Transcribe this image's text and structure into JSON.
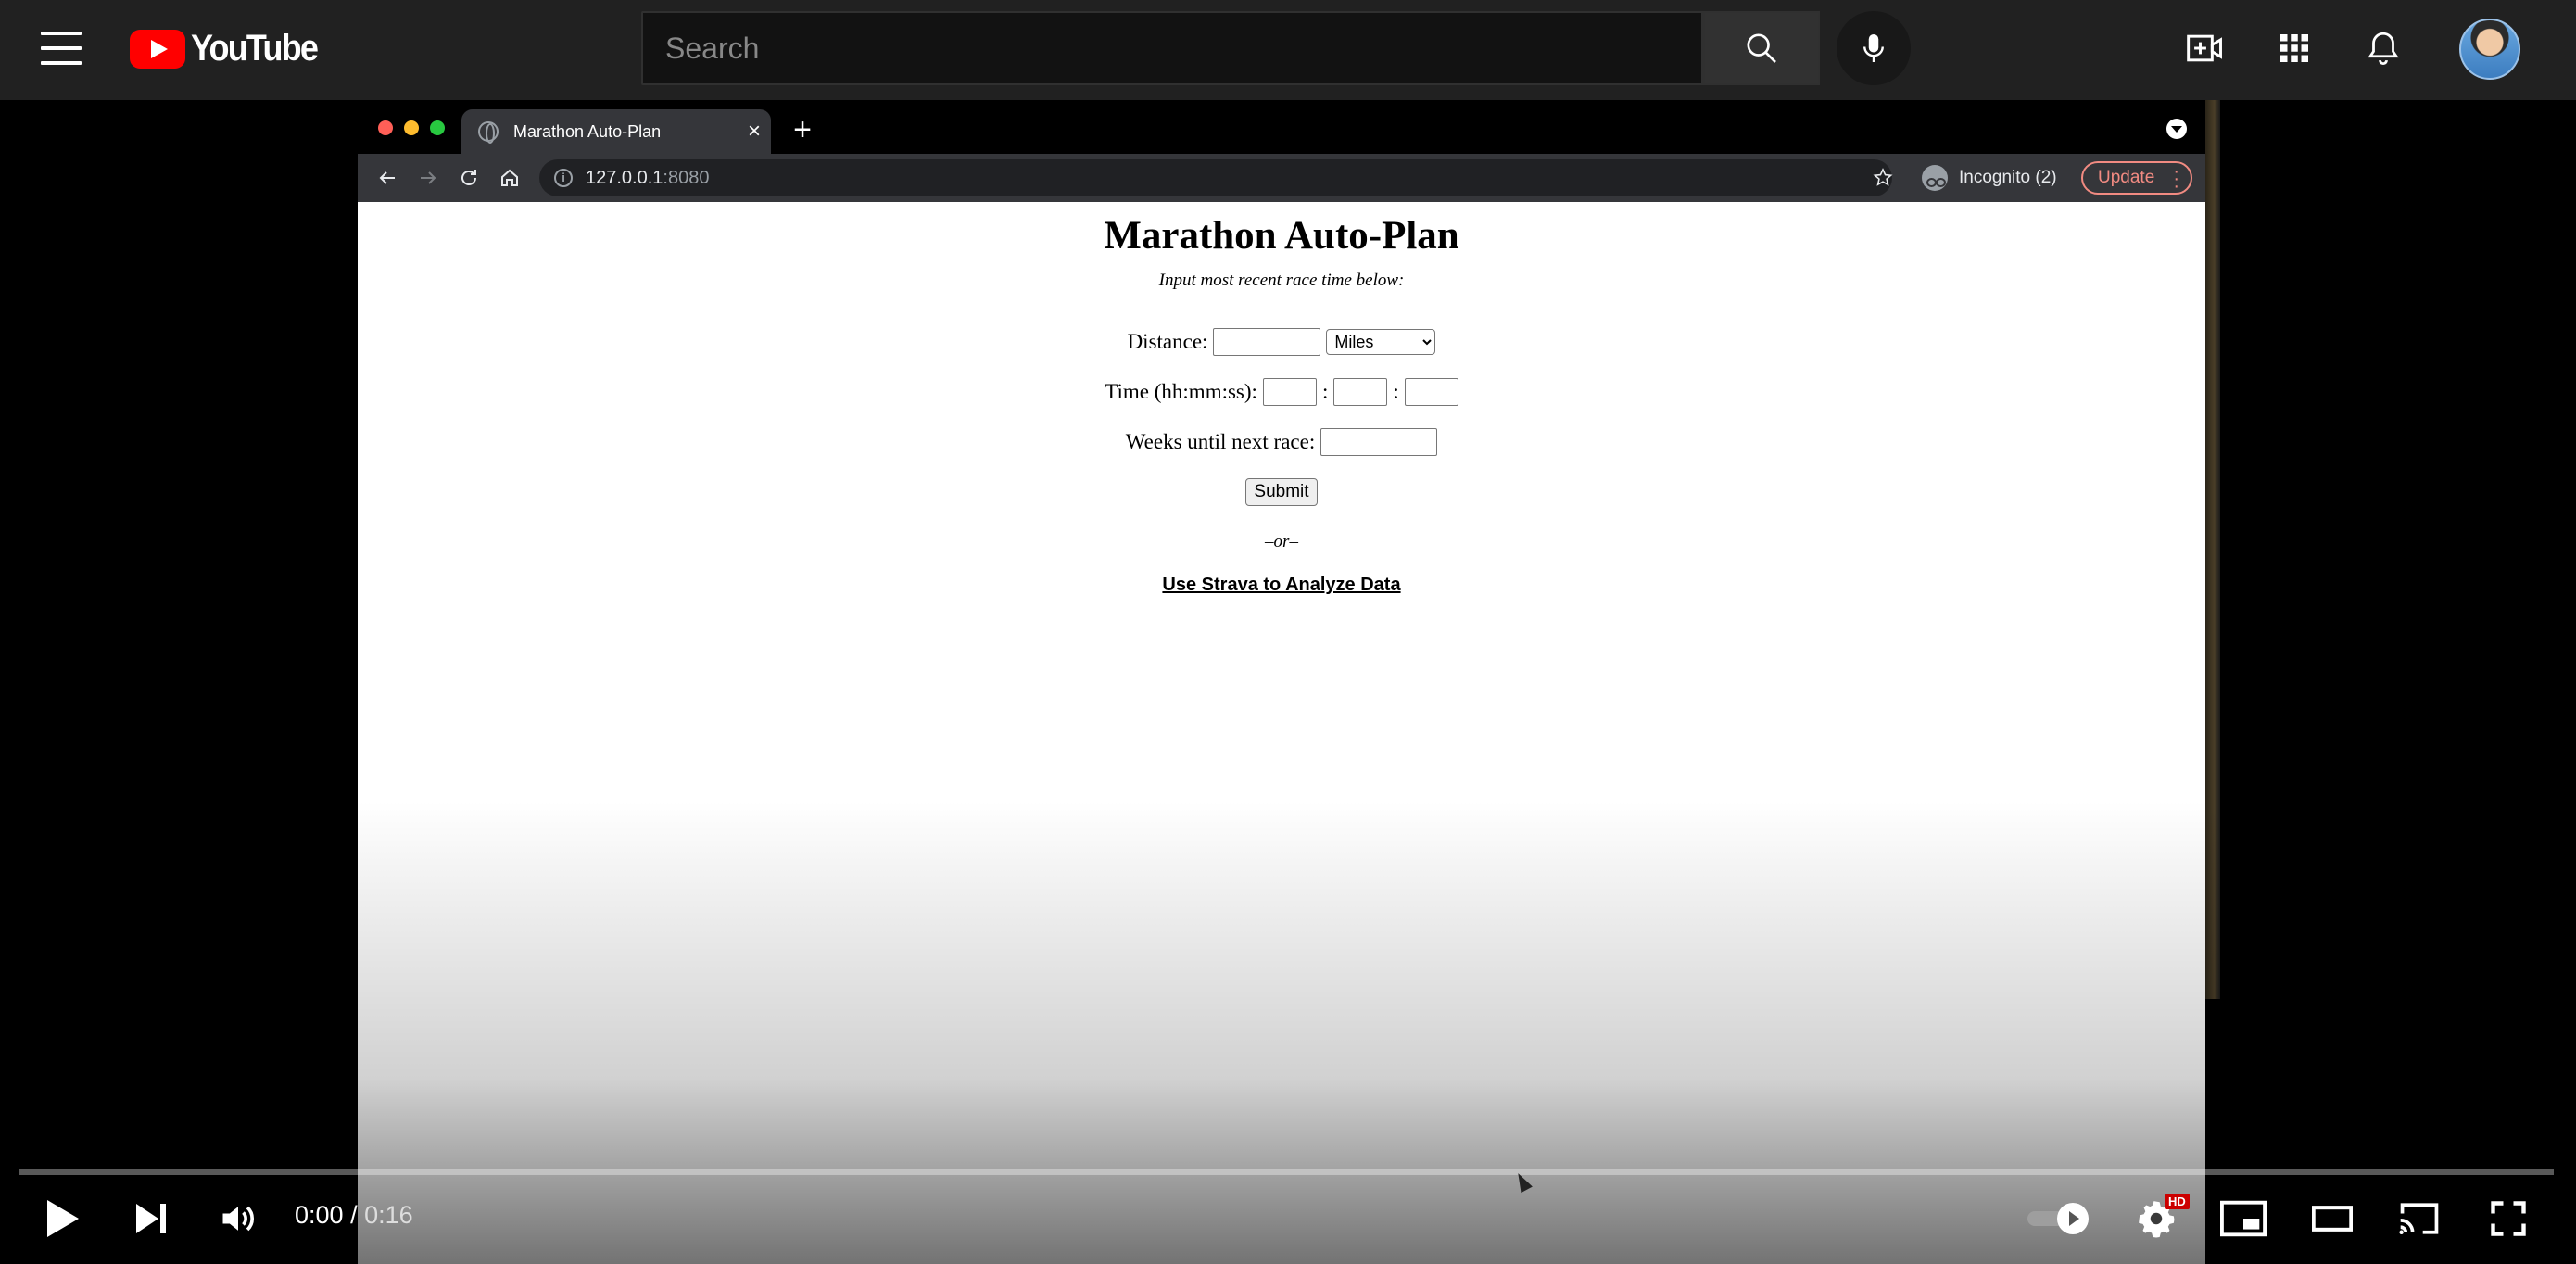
{
  "youtube": {
    "logo_text": "YouTube",
    "search": {
      "placeholder": "Search",
      "value": ""
    }
  },
  "browser": {
    "tab_title": "Marathon Auto-Plan",
    "tab_close": "×",
    "new_tab": "+",
    "url_host": "127.0.0.1",
    "url_port": ":8080",
    "incognito_label": "Incognito (2)",
    "update_label": "Update"
  },
  "page": {
    "title": "Marathon Auto-Plan",
    "subtitle": "Input most recent race time below:",
    "distance_label": "Distance:",
    "distance_value": "",
    "unit_selected": "Miles",
    "time_label": "Time (hh:mm:ss):",
    "time_sep": ":",
    "weeks_label": "Weeks until next race:",
    "weeks_value": "",
    "submit_label": "Submit",
    "or_text": "–or–",
    "strava_link": "Use Strava to Analyze Data"
  },
  "player": {
    "current_time": "0:00",
    "separator": " / ",
    "duration": "0:16",
    "progress_fraction": 0,
    "hd_badge": "HD"
  },
  "colors": {
    "yt_red": "#ff0000",
    "masthead_bg": "#212121",
    "update_red": "#f28b82"
  }
}
